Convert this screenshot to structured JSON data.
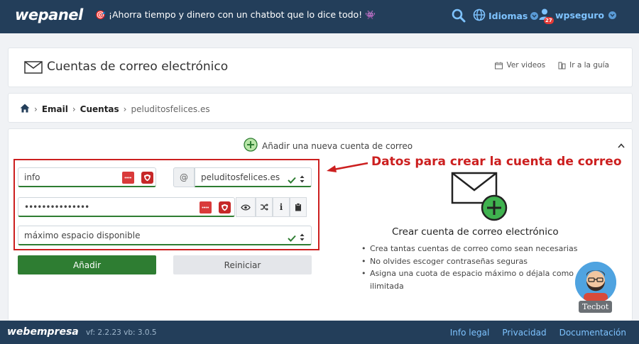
{
  "header": {
    "logo": "wepanel",
    "promo": "¡Ahorra tiempo y dinero con un chatbot que lo dice todo!",
    "languages_label": "Idiomas",
    "username": "wpseguro",
    "notification_count": "27"
  },
  "page": {
    "title": "Cuentas de correo electrónico",
    "link_videos": "Ver videos",
    "link_guide": "Ir a la guía"
  },
  "breadcrumb": {
    "items": [
      "Email",
      "Cuentas"
    ],
    "current": "peluditosfelices.es"
  },
  "form": {
    "add_new_label": "Añadir una nueva cuenta de correo",
    "username_value": "info",
    "at_sign": "@",
    "domain_value": "peluditosfelices.es",
    "password_value": "•••••••••••••••",
    "quota_value": "máximo espacio disponible",
    "add_button": "Añadir",
    "reset_button": "Reiniciar"
  },
  "annotation": "Datos para crear la cuenta de correo",
  "info": {
    "title": "Crear cuenta de correo electrónico",
    "bullets": [
      "Crea tantas cuentas de correo como sean necesarias",
      "No olvides escoger contraseñas seguras",
      "Asigna una cuota de espacio máximo o déjala como ilimitada"
    ]
  },
  "tecbot_label": "Tecbot",
  "footer": {
    "logo": "webempresa",
    "version": "vf: 2.2.23 vb: 3.0.5",
    "links": [
      "Info legal",
      "Privacidad",
      "Documentación"
    ]
  },
  "colors": {
    "topbar": "#233e5a",
    "accent_blue": "#7ec3ff",
    "success_green": "#2e7d32",
    "annotation_red": "#cc1f1f"
  }
}
